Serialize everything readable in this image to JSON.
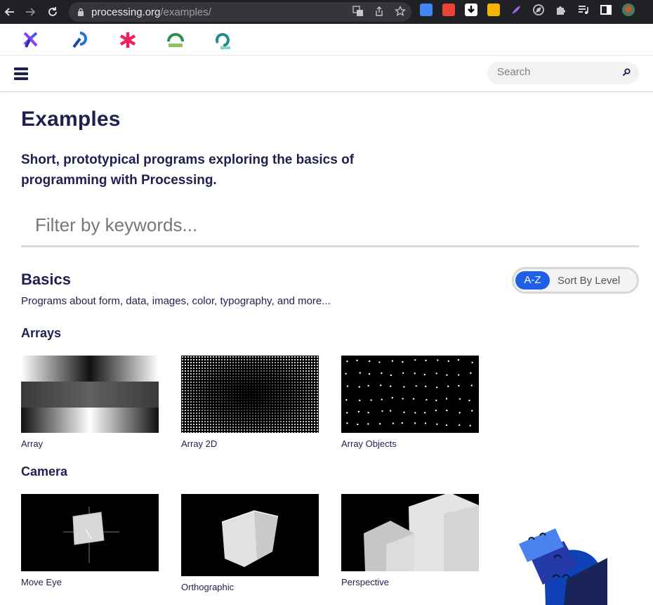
{
  "browser": {
    "url_host": "processing.org",
    "url_path": "/examples/"
  },
  "header": {
    "search_placeholder": "Search"
  },
  "page": {
    "title": "Examples",
    "intro": "Short, prototypical programs exploring the basics of programming with Processing.",
    "filter_placeholder": "Filter by keywords..."
  },
  "category": {
    "title": "Basics",
    "description": "Programs about form, data, images, color, typography, and more..."
  },
  "sort": {
    "az_label": "A-Z",
    "level_label": "Sort By Level"
  },
  "sections": [
    {
      "title": "Arrays",
      "examples": [
        "Array",
        "Array 2D",
        "Array Objects"
      ]
    },
    {
      "title": "Camera",
      "examples": [
        "Move Eye",
        "Orthographic",
        "Perspective"
      ]
    }
  ],
  "colors": {
    "text": "#1e2050",
    "accent": "#1f5fe6",
    "chrome": "#202124"
  }
}
